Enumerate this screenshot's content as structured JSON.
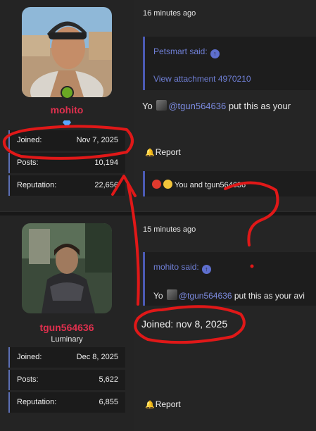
{
  "post1": {
    "username": "mohito",
    "badge_icon": "diamond-icon",
    "stats": [
      {
        "label": "Joined:",
        "value": "Nov 7, 2025"
      },
      {
        "label": "Posts:",
        "value": "10,194"
      },
      {
        "label": "Reputation:",
        "value": "22,656"
      }
    ],
    "time": "16 minutes ago",
    "quote_author": "Petsmart said:",
    "quote_link": "View attachment 4970210",
    "message_prefix": "Yo",
    "message_mention": "@tgun564636",
    "message_suffix": " put this as your",
    "report": "Report",
    "reactions_text": "You and tgun564636"
  },
  "post2": {
    "username": "tgun564636",
    "user_title": "Luminary",
    "stats": [
      {
        "label": "Joined:",
        "value": "Dec 8, 2025"
      },
      {
        "label": "Posts:",
        "value": "5,622"
      },
      {
        "label": "Reputation:",
        "value": "6,855"
      }
    ],
    "time": "15 minutes ago",
    "quote_author": "mohito said:",
    "quote_prefix": "Yo",
    "quote_mention": "@tgun564636",
    "quote_suffix": " put this as your avi",
    "report": "Report"
  },
  "annotation": {
    "handwritten": "Joined: nov 8, 2025",
    "question_mark": "?",
    "color": "#e01818"
  }
}
